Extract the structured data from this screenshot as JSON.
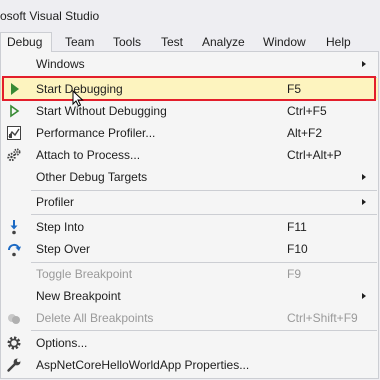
{
  "window": {
    "title": "osoft Visual Studio"
  },
  "menubar": {
    "items": [
      {
        "label": "Debug",
        "active": true
      },
      {
        "label": "Team"
      },
      {
        "label": "Tools"
      },
      {
        "label": "Test"
      },
      {
        "label": "Analyze"
      },
      {
        "label": "Window"
      },
      {
        "label": "Help"
      }
    ]
  },
  "debug_menu": {
    "items": [
      {
        "label": "Windows",
        "shortcut": "",
        "submenu": true,
        "icon": "none"
      },
      {
        "label": "Start Debugging",
        "shortcut": "F5",
        "icon": "play-icon",
        "highlighted": true
      },
      {
        "label": "Start Without Debugging",
        "shortcut": "Ctrl+F5",
        "icon": "play-outline-icon"
      },
      {
        "label": "Performance Profiler...",
        "shortcut": "Alt+F2",
        "icon": "profiler-icon"
      },
      {
        "label": "Attach to Process...",
        "shortcut": "Ctrl+Alt+P",
        "icon": "attach-gears-icon"
      },
      {
        "label": "Other Debug Targets",
        "shortcut": "",
        "submenu": true,
        "icon": "none"
      },
      {
        "label": "Profiler",
        "shortcut": "",
        "submenu": true,
        "icon": "none"
      },
      {
        "label": "Step Into",
        "shortcut": "F11",
        "icon": "step-into-icon"
      },
      {
        "label": "Step Over",
        "shortcut": "F10",
        "icon": "step-over-icon"
      },
      {
        "label": "Toggle Breakpoint",
        "shortcut": "F9",
        "disabled": true,
        "icon": "none"
      },
      {
        "label": "New Breakpoint",
        "shortcut": "",
        "submenu": true,
        "icon": "none"
      },
      {
        "label": "Delete All Breakpoints",
        "shortcut": "Ctrl+Shift+F9",
        "disabled": true,
        "icon": "delete-breakpoints-icon"
      },
      {
        "label": "Options...",
        "shortcut": "",
        "icon": "gear-icon"
      },
      {
        "label": "AspNetCoreHelloWorldApp Properties...",
        "shortcut": "",
        "icon": "wrench-icon"
      }
    ]
  },
  "colors": {
    "background": "#eeeef2",
    "menu_bg": "#f5f5f5",
    "highlight": "#fdf4bf",
    "annotation_border": "#e31e2b",
    "play_green": "#388a34",
    "disabled_text": "#9a9a9a"
  }
}
